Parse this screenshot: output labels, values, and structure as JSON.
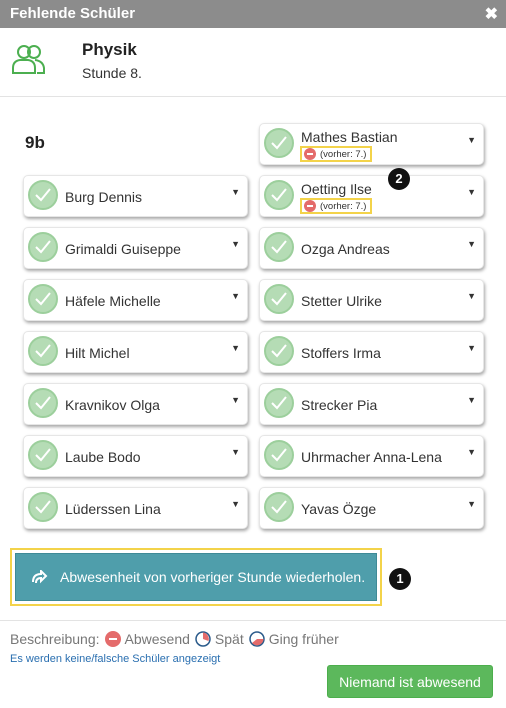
{
  "dialog": {
    "title": "Fehlende Schüler",
    "close_glyph": "✖"
  },
  "lesson": {
    "subject": "Physik",
    "period": "Stunde 8."
  },
  "class_name": "9b",
  "students_left": [
    {
      "name": "Burg Dennis"
    },
    {
      "name": "Grimaldi Guiseppe"
    },
    {
      "name": "Häfele Michelle"
    },
    {
      "name": "Hilt Michel"
    },
    {
      "name": "Kravnikov Olga"
    },
    {
      "name": "Laube Bodo"
    },
    {
      "name": "Lüderssen Lina"
    }
  ],
  "students_right": [
    {
      "name": "Mathes Bastian",
      "badge": "(vorher: 7.)"
    },
    {
      "name": "Oetting Ilse",
      "badge": "(vorher: 7.)"
    },
    {
      "name": "Ozga Andreas"
    },
    {
      "name": "Stetter Ulrike"
    },
    {
      "name": "Stoffers Irma"
    },
    {
      "name": "Strecker Pia"
    },
    {
      "name": "Uhrmacher Anna-Lena"
    },
    {
      "name": "Yavas Özge"
    }
  ],
  "markers": {
    "one": "1",
    "two": "2"
  },
  "repeat_button": "Abwesenheit von vorheriger Stunde wiederholen.",
  "legend": {
    "label": "Beschreibung:",
    "absent": "Abwesend",
    "late": "Spät",
    "left_early": "Ging früher"
  },
  "missing_link": "Es werden keine/falsche Schüler angezeigt",
  "nobody_absent_button": "Niemand ist abwesend",
  "colors": {
    "titlebar": "#8c8c8c",
    "teal": "#4f9eab",
    "green": "#5cb85c",
    "highlight": "#f3d34a",
    "absent_red": "#e46b6b"
  }
}
